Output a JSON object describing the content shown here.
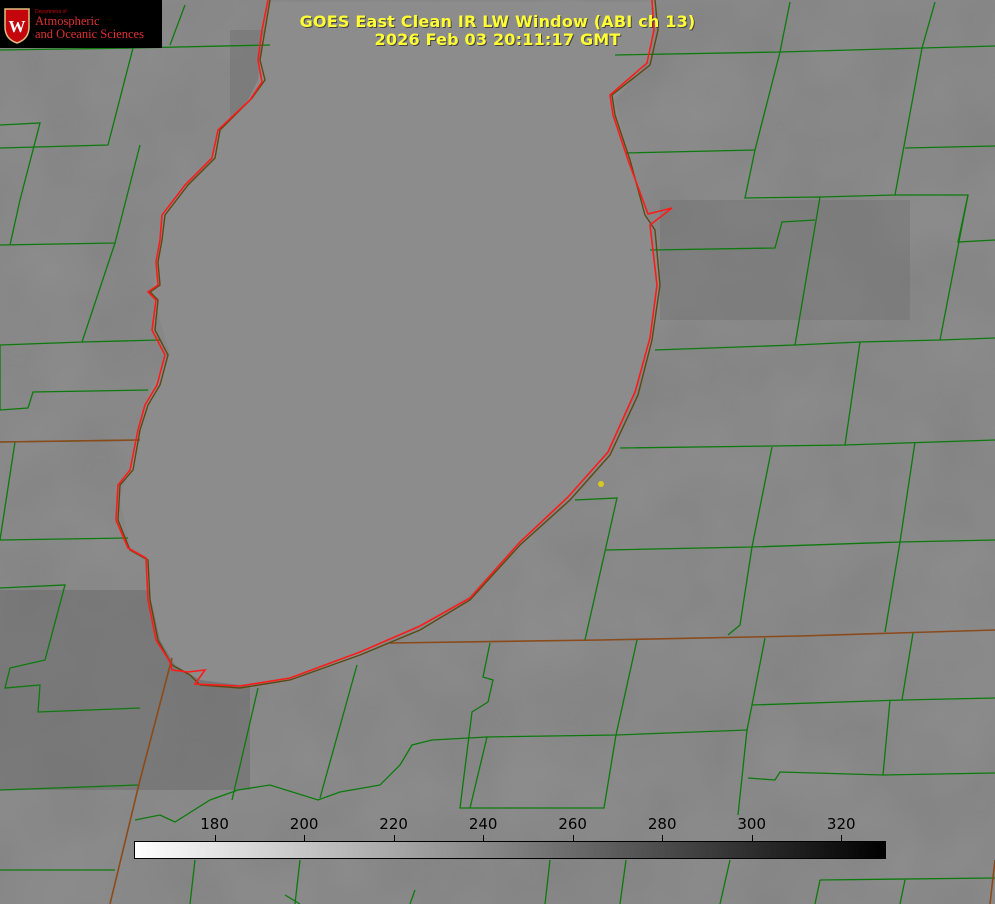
{
  "image": {
    "title_line1": "GOES East Clean IR LW Window (ABI ch 13)",
    "title_line2": "2026 Feb 03 20:11:17 GMT"
  },
  "logo": {
    "dept": "Department of",
    "line1": "Atmospheric",
    "line2": "and Oceanic Sciences",
    "crest_letter": "W"
  },
  "colorbar": {
    "tick_labels": [
      "180",
      "200",
      "220",
      "240",
      "260",
      "280",
      "300",
      "320"
    ],
    "min": 162,
    "max": 330,
    "gradient_start": "#ffffff",
    "gradient_end": "#000000"
  },
  "colors": {
    "title": "#ffff33",
    "boundary_green": "#0c7a0c",
    "state_line": "#8b4a1a",
    "coastline_red": "#ff1a1a",
    "marker": "#d9c820"
  }
}
